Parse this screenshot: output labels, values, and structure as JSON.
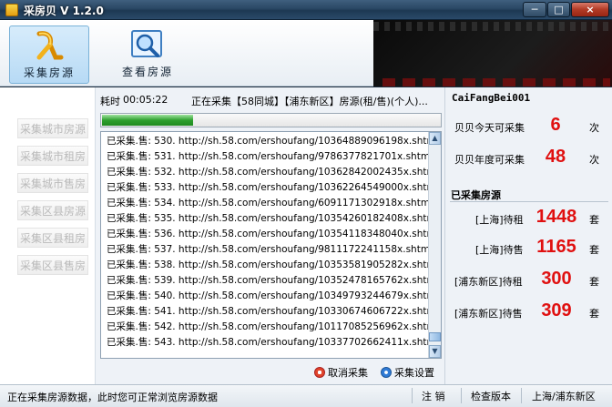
{
  "window": {
    "title": "采房贝 V 1.2.0",
    "min_label": "─",
    "max_label": "□",
    "close_label": "×"
  },
  "toolbar": {
    "collect_label": "采集房源",
    "view_label": "查看房源"
  },
  "sidebar": {
    "items": [
      "采集城市房源",
      "采集城市租房",
      "采集城市售房",
      "采集区县房源",
      "采集区县租房",
      "采集区县售房"
    ]
  },
  "progress": {
    "elapsed_label": "耗时",
    "elapsed_time": "00:05:22",
    "status": "正在采集【58同城】【浦东新区】房源(租/售)(个人)...",
    "percent": 27
  },
  "log": [
    "已采集.售: 530.  http://sh.58.com/ershoufang/10364889096198x.shtml",
    "已采集.售: 531.  http://sh.58.com/ershoufang/9786377821701x.shtml",
    "已采集.售: 532.  http://sh.58.com/ershoufang/10362842002435x.shtml",
    "已采集.售: 533.  http://sh.58.com/ershoufang/10362264549000x.shtml",
    "已采集.售: 534.  http://sh.58.com/ershoufang/6091171302918x.shtml",
    "已采集.售: 535.  http://sh.58.com/ershoufang/10354260182408x.shtml",
    "已采集.售: 536.  http://sh.58.com/ershoufang/10354118348040x.shtml",
    "已采集.售: 537.  http://sh.58.com/ershoufang/9811172241158x.shtml",
    "已采集.售: 538.  http://sh.58.com/ershoufang/10353581905282x.shtml",
    "已采集.售: 539.  http://sh.58.com/ershoufang/10352478165762x.shtml",
    "已采集.售: 540.  http://sh.58.com/ershoufang/10349793244679x.shtml",
    "已采集.售: 541.  http://sh.58.com/ershoufang/10330674606722x.shtml",
    "已采集.售: 542.  http://sh.58.com/ershoufang/10117085256962x.shtml",
    "已采集.售: 543.  http://sh.58.com/ershoufang/10337702662411x.shtml"
  ],
  "actions": {
    "cancel_label": "取消采集",
    "settings_label": "采集设置"
  },
  "right": {
    "user_id": "CaiFangBei001",
    "today_label": "贝贝今天可采集",
    "today_value": "6",
    "today_unit": "次",
    "year_label": "贝贝年度可采集",
    "year_value": "48",
    "year_unit": "次",
    "collected_title": "已采集房源",
    "stats": [
      {
        "label": "[上海]待租",
        "value": "1448",
        "unit": "套"
      },
      {
        "label": "[上海]待售",
        "value": "1165",
        "unit": "套"
      },
      {
        "label": "[浦东新区]待租",
        "value": "300",
        "unit": "套"
      },
      {
        "label": "[浦东新区]待售",
        "value": "309",
        "unit": "套"
      }
    ]
  },
  "statusbar": {
    "message": "正在采集房源数据，此时您可正常浏览房源数据",
    "logout": "注  销",
    "check_version": "检查版本",
    "location": "上海/浦东新区"
  },
  "colors": {
    "accent_red": "#e01010",
    "progress_green": "#2ea02e"
  }
}
